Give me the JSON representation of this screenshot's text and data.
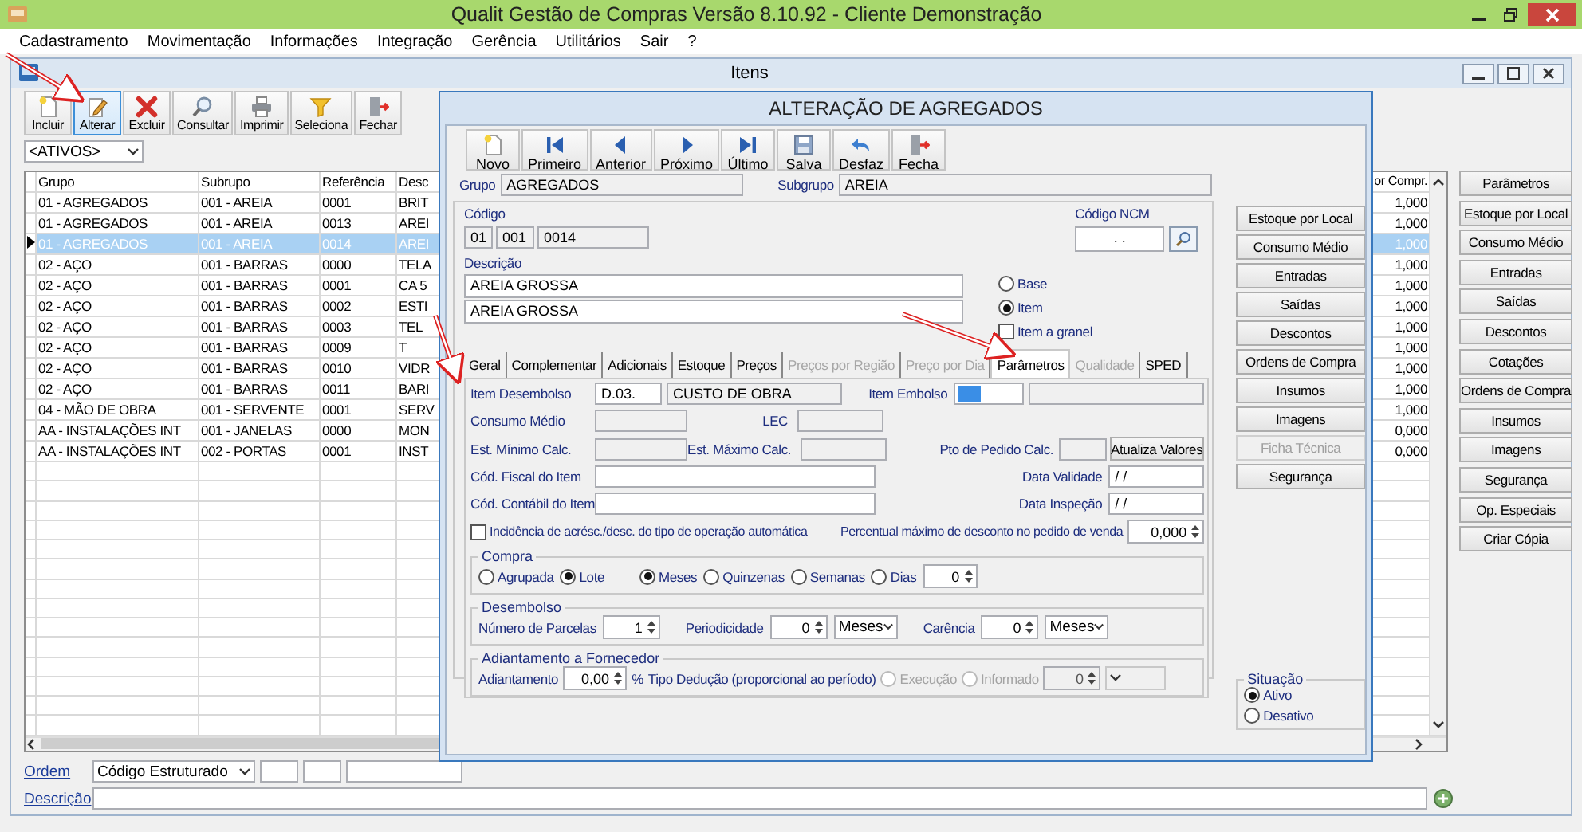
{
  "app": {
    "title": "Qualit Gestão de Compras Versão 8.10.92 - Cliente Demonstração",
    "menu": [
      "Cadastramento",
      "Movimentação",
      "Informações",
      "Integração",
      "Gerência",
      "Utilitários",
      "Sair",
      "?"
    ]
  },
  "itens": {
    "title": "Itens",
    "toolbar": [
      {
        "label": "Incluir",
        "selected": false
      },
      {
        "label": "Alterar",
        "selected": true
      },
      {
        "label": "Excluir",
        "selected": false
      },
      {
        "label": "Consultar",
        "selected": false
      },
      {
        "label": "Imprimir",
        "selected": false
      },
      {
        "label": "Seleciona",
        "selected": false
      },
      {
        "label": "Fechar",
        "selected": false
      }
    ],
    "filter": "<ATIVOS>",
    "table": {
      "columns": [
        "Grupo",
        "Subrupo",
        "Referência",
        "Desc",
        "or Compr."
      ],
      "rows": [
        {
          "cells": [
            "01 - AGREGADOS",
            "001 - AREIA",
            "0001",
            "BRIT",
            "1,000"
          ],
          "selected": false
        },
        {
          "cells": [
            "01 - AGREGADOS",
            "001 - AREIA",
            "0013",
            "AREI",
            "1,000"
          ],
          "selected": false
        },
        {
          "cells": [
            "01 - AGREGADOS",
            "001 - AREIA",
            "0014",
            "AREI",
            "1,000"
          ],
          "selected": true
        },
        {
          "cells": [
            "02 - AÇO",
            "001 - BARRAS",
            "0000",
            "TELA",
            "1,000"
          ],
          "selected": false
        },
        {
          "cells": [
            "02 - AÇO",
            "001 - BARRAS",
            "0001",
            "CA 5",
            "1,000"
          ],
          "selected": false
        },
        {
          "cells": [
            "02 - AÇO",
            "001 - BARRAS",
            "0002",
            "ESTI",
            "1,000"
          ],
          "selected": false
        },
        {
          "cells": [
            "02 - AÇO",
            "001 - BARRAS",
            "0003",
            "TEL",
            "1,000"
          ],
          "selected": false
        },
        {
          "cells": [
            "02 - AÇO",
            "001 - BARRAS",
            "0009",
            "T",
            "1,000"
          ],
          "selected": false
        },
        {
          "cells": [
            "02 - AÇO",
            "001 - BARRAS",
            "0010",
            "VIDR",
            "1,000"
          ],
          "selected": false
        },
        {
          "cells": [
            "02 - AÇO",
            "001 - BARRAS",
            "0011",
            "BARI",
            "1,000"
          ],
          "selected": false
        },
        {
          "cells": [
            "04 - MÃO DE OBRA",
            "001 - SERVENTE",
            "0001",
            "SERV",
            "1,000"
          ],
          "selected": false
        },
        {
          "cells": [
            "AA - INSTALAÇÕES INT",
            "001 - JANELAS",
            "0000",
            "MON",
            "0,000"
          ],
          "selected": false
        },
        {
          "cells": [
            "AA - INSTALAÇÕES INT",
            "002 - PORTAS",
            "0001",
            "INST",
            "0,000"
          ],
          "selected": false
        }
      ]
    },
    "buttons": [
      "Parâmetros",
      "Estoque por Local",
      "Consumo Médio",
      "Entradas",
      "Saídas",
      "Descontos",
      "Cotações",
      "Ordens de Compra",
      "Insumos",
      "Imagens",
      "Segurança",
      "Op. Especiais",
      "Criar Cópia"
    ],
    "ordem": {
      "label": "Ordem",
      "value": "Código Estruturado"
    },
    "descricao": {
      "label": "Descrição"
    }
  },
  "dialog": {
    "title": "ALTERAÇÃO DE AGREGADOS",
    "toolbar": [
      "Novo",
      "Primeiro",
      "Anterior",
      "Próximo",
      "Último",
      "Salva",
      "Desfaz",
      "Fecha"
    ],
    "grupo": {
      "label": "Grupo",
      "value": "AGREGADOS"
    },
    "subgrupo": {
      "label": "Subgrupo",
      "value": "AREIA"
    },
    "codigo": {
      "label": "Código",
      "parts": [
        "01",
        "001",
        "0014"
      ]
    },
    "ncm": {
      "label": "Código NCM",
      "value": ". ."
    },
    "descricao": {
      "label": "Descrição",
      "lines": [
        "AREIA GROSSA",
        "AREIA GROSSA"
      ]
    },
    "tipo": [
      {
        "label": "Base",
        "selected": false
      },
      {
        "label": "Item",
        "selected": true
      }
    ],
    "granel": {
      "label": "Item a granel",
      "checked": false
    },
    "tabs": [
      {
        "label": "Geral",
        "selected": false,
        "disabled": false
      },
      {
        "label": "Complementar",
        "selected": false,
        "disabled": false
      },
      {
        "label": "Adicionais",
        "selected": false,
        "disabled": false
      },
      {
        "label": "Estoque",
        "selected": false,
        "disabled": false
      },
      {
        "label": "Preços",
        "selected": false,
        "disabled": false
      },
      {
        "label": "Preços por Região",
        "selected": false,
        "disabled": true
      },
      {
        "label": "Preço por Dia",
        "selected": false,
        "disabled": true
      },
      {
        "label": "Parâmetros",
        "selected": true,
        "disabled": false
      },
      {
        "label": "Qualidade",
        "selected": false,
        "disabled": true
      },
      {
        "label": "SPED",
        "selected": false,
        "disabled": false
      }
    ],
    "item_desembolso": {
      "label": "Item Desembolso",
      "code": "D.03.",
      "name": "CUSTO DE OBRA"
    },
    "item_embolso": {
      "label": "Item Embolso"
    },
    "consumo_medio": {
      "label": "Consumo Médio"
    },
    "lec": {
      "label": "LEC"
    },
    "est_minimo": {
      "label": "Est. Mínimo Calc."
    },
    "est_maximo": {
      "label": "Est. Máximo Calc."
    },
    "pto_pedido": {
      "label": "Pto de Pedido Calc."
    },
    "atualiza": "Atualiza Valores",
    "cod_fiscal": {
      "label": "Cód. Fiscal do Item"
    },
    "data_validade": {
      "label": "Data Validade",
      "value": "/ /"
    },
    "cod_contabil": {
      "label": "Cód. Contábil do Item"
    },
    "data_inspecao": {
      "label": "Data Inspeção",
      "value": "/ /"
    },
    "incidencia": {
      "label": "Incidência de acrésc./desc. do tipo de operação automática",
      "checked": false
    },
    "percentual": {
      "label": "Percentual máximo de desconto no pedido de venda",
      "value": "0,000"
    },
    "compra": {
      "title": "Compra",
      "mode": [
        {
          "label": "Agrupada",
          "selected": false
        },
        {
          "label": "Lote",
          "selected": true
        }
      ],
      "period": [
        {
          "label": "Meses",
          "selected": true
        },
        {
          "label": "Quinzenas",
          "selected": false
        },
        {
          "label": "Semanas",
          "selected": false
        },
        {
          "label": "Dias",
          "selected": false
        }
      ],
      "value": "0"
    },
    "desembolso": {
      "title": "Desembolso",
      "parcelas": {
        "label": "Número de Parcelas",
        "value": "1"
      },
      "periodicidade": {
        "label": "Periodicidade",
        "value": "0",
        "unit": "Meses"
      },
      "carencia": {
        "label": "Carência",
        "value": "0",
        "unit": "Meses"
      }
    },
    "adiantamento": {
      "title": "Adiantamento a Fornecedor",
      "label": "Adiantamento",
      "value": "0,00",
      "percent": "%",
      "deducao": "Tipo Dedução (proporcional ao período)",
      "options": [
        {
          "label": "Execução",
          "selected": false,
          "disabled": true
        },
        {
          "label": "Informado",
          "selected": false,
          "disabled": true
        }
      ],
      "count": "0"
    },
    "buttons": [
      {
        "label": "Estoque por Local",
        "disabled": false
      },
      {
        "label": "Consumo Médio",
        "disabled": false
      },
      {
        "label": "Entradas",
        "disabled": false
      },
      {
        "label": "Saídas",
        "disabled": false
      },
      {
        "label": "Descontos",
        "disabled": false
      },
      {
        "label": "Ordens de Compra",
        "disabled": false
      },
      {
        "label": "Insumos",
        "disabled": false
      },
      {
        "label": "Imagens",
        "disabled": false
      },
      {
        "label": "Ficha Técnica",
        "disabled": true
      },
      {
        "label": "Segurança",
        "disabled": false
      }
    ],
    "situacao": {
      "title": "Situação",
      "options": [
        {
          "label": "Ativo",
          "selected": true
        },
        {
          "label": "Desativo",
          "selected": false
        }
      ]
    }
  }
}
